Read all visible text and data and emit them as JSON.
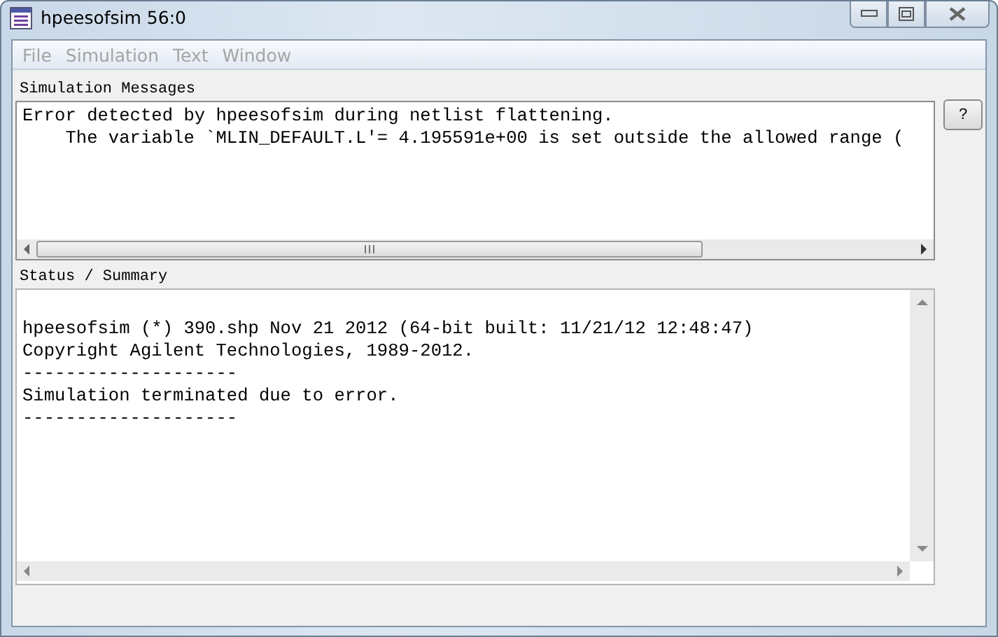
{
  "window": {
    "title": "hpeesofsim 56:0"
  },
  "menu": [
    {
      "label": "File",
      "disabled": true
    },
    {
      "label": "Simulation",
      "disabled": true
    },
    {
      "label": "Text",
      "disabled": true
    },
    {
      "label": "Window",
      "disabled": true
    }
  ],
  "simulation_messages": {
    "label": "Simulation Messages",
    "lines": [
      "Error detected by hpeesofsim during netlist flattening.",
      "    The variable `MLIN_DEFAULT.L'= 4.195591e+00 is set outside the allowed range ("
    ],
    "help_button": "?"
  },
  "status_summary": {
    "label": "Status / Summary",
    "lines": [
      "hpeesofsim (*) 390.shp Nov 21 2012 (64-bit built: 11/21/12 12:48:47)",
      "Copyright Agilent Technologies, 1989-2012.",
      "--------------------",
      "Simulation terminated due to error.",
      "--------------------"
    ]
  }
}
